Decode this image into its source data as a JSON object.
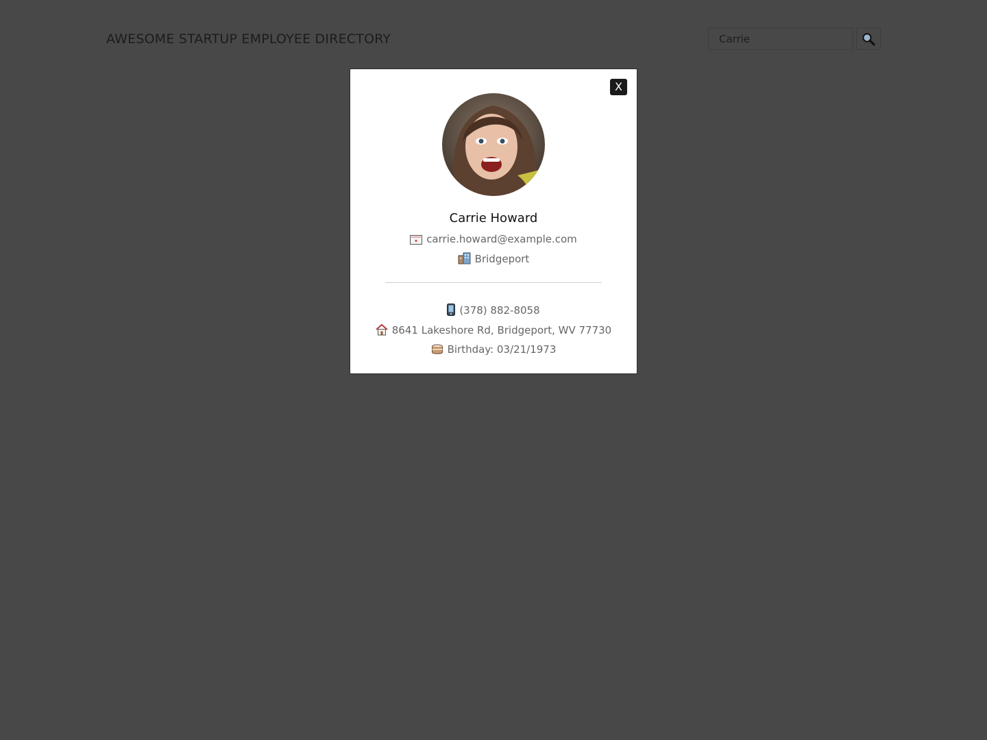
{
  "header": {
    "title": "AWESOME STARTUP EMPLOYEE DIRECTORY"
  },
  "search": {
    "value": "Carrie",
    "button_icon": "search-icon"
  },
  "modal": {
    "close_label": "X",
    "avatar_icon": "avatar",
    "name": "Carrie Howard",
    "email": "carrie.howard@example.com",
    "email_icon": "email-icon",
    "city": "Bridgeport",
    "city_icon": "city-icon",
    "phone": "(378) 882-8058",
    "phone_icon": "phone-icon",
    "address": "8641 Lakeshore Rd, Bridgeport, WV 77730",
    "address_icon": "house-icon",
    "birthday": "Birthday: 03/21/1973",
    "birthday_icon": "cake-icon"
  },
  "colors": {
    "overlay_background": "#484848",
    "modal_background": "#ffffff",
    "close_button": "#1b1b1b",
    "info_text": "#666666"
  }
}
